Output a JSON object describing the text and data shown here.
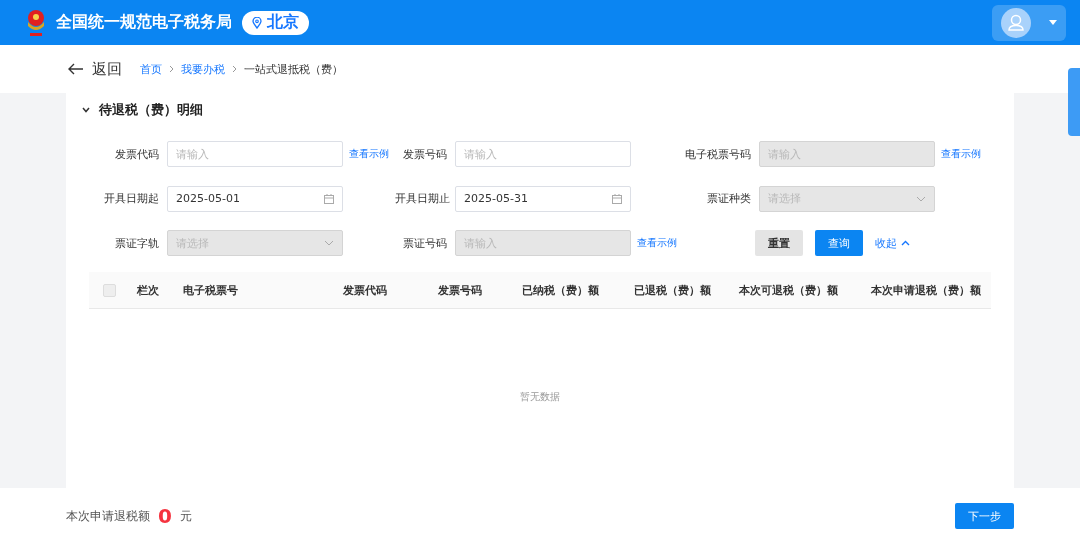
{
  "header": {
    "title": "全国统一规范电子税务局",
    "location": "北京"
  },
  "breadcrumb": {
    "back": "返回",
    "items": [
      {
        "label": "首页",
        "link": true
      },
      {
        "label": "我要办税",
        "link": true
      },
      {
        "label": "一站式退抵税（费）",
        "link": false
      }
    ]
  },
  "section": {
    "title": "待退税（费）明细",
    "expanded": true
  },
  "filters": [
    {
      "label": "发票代码",
      "kind": "input",
      "placeholder": "请输入",
      "disabled": false,
      "link": "查看示例"
    },
    {
      "label": "发票号码",
      "kind": "input",
      "placeholder": "请输入",
      "disabled": false
    },
    {
      "label": "电子税票号码",
      "kind": "input",
      "placeholder": "请输入",
      "disabled": true,
      "link": "查看示例"
    },
    {
      "label": "开具日期起",
      "kind": "date",
      "value": "2025-05-01",
      "disabled": false
    },
    {
      "label": "开具日期止",
      "kind": "date",
      "value": "2025-05-31",
      "disabled": false
    },
    {
      "label": "票证种类",
      "kind": "select",
      "placeholder": "请选择",
      "disabled": true
    },
    {
      "label": "票证字轨",
      "kind": "select",
      "placeholder": "请选择",
      "disabled": true
    },
    {
      "label": "票证号码",
      "kind": "input",
      "placeholder": "请输入",
      "disabled": true,
      "link": "查看示例"
    }
  ],
  "actions": {
    "reset": "重置",
    "query": "查询",
    "collapse": "收起"
  },
  "table": {
    "select_all_checked": false,
    "columns": [
      "栏次",
      "电子税票号",
      "发票代码",
      "发票号码",
      "已纳税（费）额",
      "已退税（费）额",
      "本次可退税（费）额",
      "本次申请退税（费）额"
    ],
    "empty_text": "暂无数据"
  },
  "footer": {
    "label": "本次申请退税额",
    "amount": "0",
    "unit": "元",
    "next": "下一步"
  }
}
